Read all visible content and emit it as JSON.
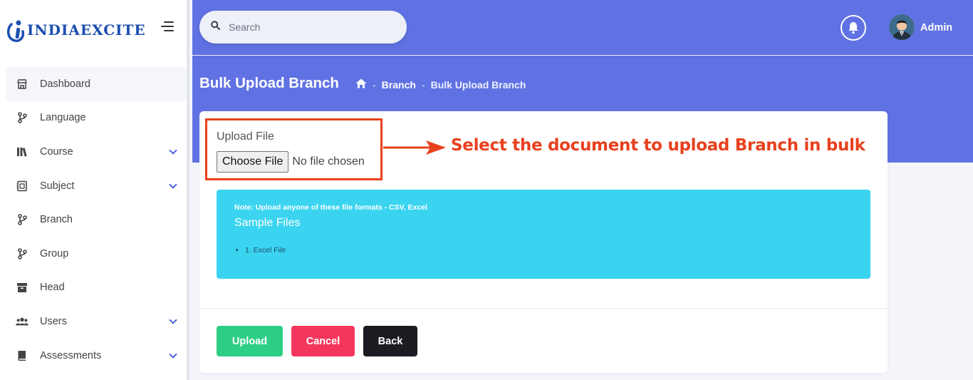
{
  "brand": {
    "name": "INDIAEXCITE",
    "color": "#1c4fb0"
  },
  "search": {
    "placeholder": "Search"
  },
  "user": {
    "name": "Admin"
  },
  "sidebar": {
    "items": [
      {
        "label": "Dashboard",
        "icon": "store-icon",
        "active": true,
        "expandable": false
      },
      {
        "label": "Language",
        "icon": "branch-icon",
        "expandable": false
      },
      {
        "label": "Course",
        "icon": "books-icon",
        "expandable": true
      },
      {
        "label": "Subject",
        "icon": "document-icon",
        "expandable": true
      },
      {
        "label": "Branch",
        "icon": "branch-icon",
        "expandable": false
      },
      {
        "label": "Group",
        "icon": "branch-icon",
        "expandable": false
      },
      {
        "label": "Head",
        "icon": "box-icon",
        "expandable": false
      },
      {
        "label": "Users",
        "icon": "users-icon",
        "expandable": true
      },
      {
        "label": "Assessments",
        "icon": "book-icon",
        "expandable": true
      }
    ]
  },
  "page": {
    "title": "Bulk Upload Branch",
    "breadcrumb": [
      "Branch",
      "Bulk Upload Branch"
    ]
  },
  "form": {
    "upload_label": "Upload File",
    "choose_file": "Choose File",
    "file_status": "No file chosen"
  },
  "note": {
    "title": "Note: Upload anyone of these file formats - CSV, Excel",
    "subtitle": "Sample Files",
    "files": [
      "1. Excel File"
    ]
  },
  "actions": {
    "upload": "Upload",
    "cancel": "Cancel",
    "back": "Back"
  },
  "annotation": {
    "text": "Select the document to upload Branch in bulk",
    "color": "#e8401d"
  },
  "colors": {
    "header": "#6072e3",
    "note_bg": "#3bd4f0",
    "upload": "#2fce87",
    "cancel": "#f5365c",
    "back": "#1b1c22"
  }
}
